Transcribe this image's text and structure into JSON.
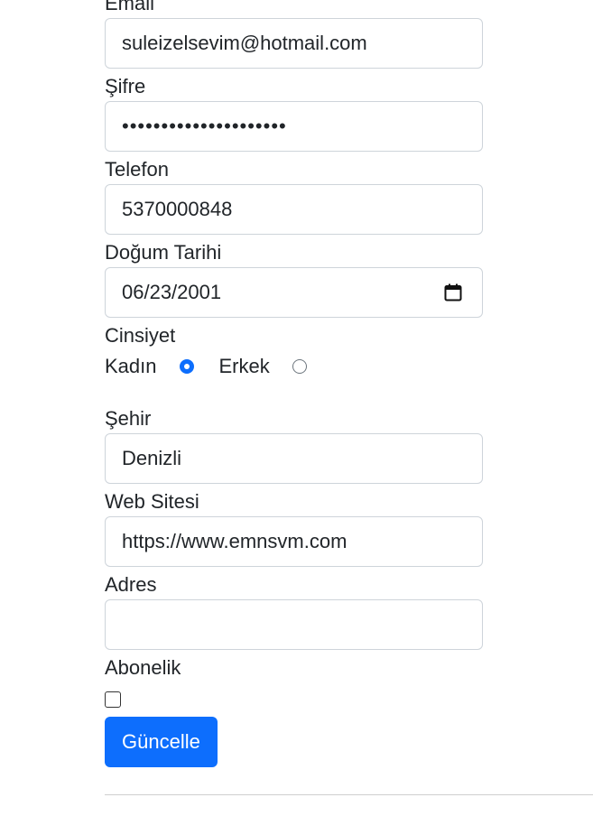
{
  "form": {
    "email": {
      "label": "Email",
      "value": "suleizelsevim@hotmail.com"
    },
    "password": {
      "label": "Şifre",
      "value": "•••••••••••••••••••••"
    },
    "phone": {
      "label": "Telefon",
      "value": "5370000848"
    },
    "birthdate": {
      "label": "Doğum Tarihi",
      "value": "06/23/2001",
      "icon": "calendar-icon"
    },
    "gender": {
      "label": "Cinsiyet",
      "options": [
        {
          "label": "Kadın",
          "checked": true
        },
        {
          "label": "Erkek",
          "checked": false
        }
      ]
    },
    "city": {
      "label": "Şehir",
      "value": "Denizli"
    },
    "website": {
      "label": "Web Sitesi",
      "value": "https://www.emnsvm.com"
    },
    "address": {
      "label": "Adres",
      "value": ""
    },
    "subscription": {
      "label": "Abonelik",
      "checked": false
    },
    "submit_label": "Güncelle"
  },
  "colors": {
    "primary": "#0d6efd",
    "border": "#ced4da",
    "text": "#212529"
  }
}
